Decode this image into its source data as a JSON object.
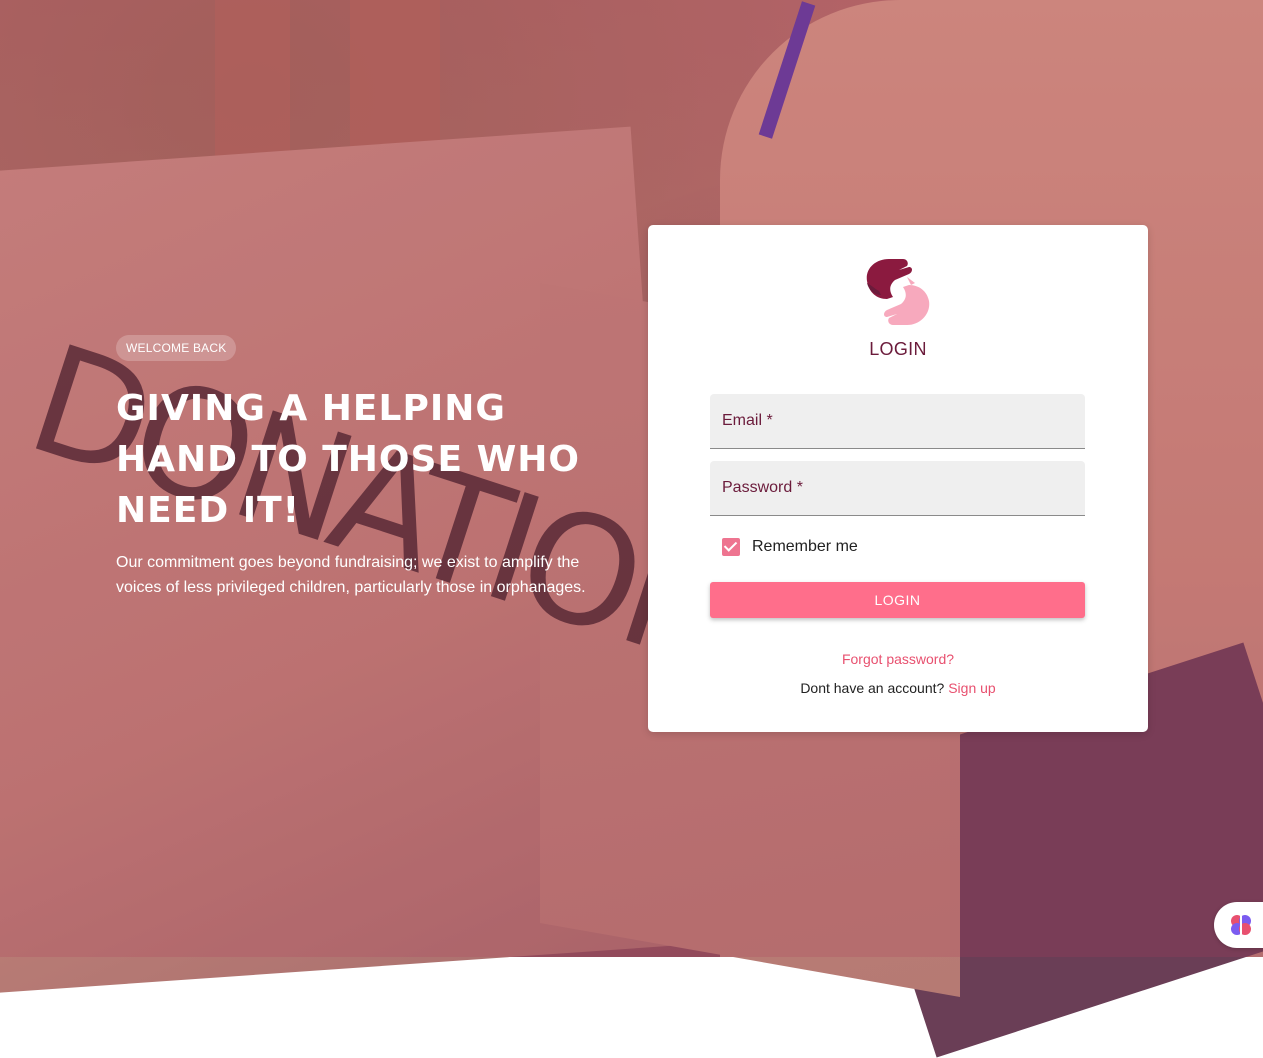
{
  "hero": {
    "badge": "WELCOME BACK",
    "headline": "GIVING A HELPING HAND TO THOSE WHO NEED IT!",
    "tagline": "Our commitment goes beyond fundraising; we exist to amplify the voices of less privileged children, particularly those in orphanages."
  },
  "background": {
    "box_text": "DONATION"
  },
  "login_card": {
    "title": "LOGIN",
    "email_label": "Email *",
    "password_label": "Password *",
    "remember_label": "Remember me",
    "remember_checked": true,
    "login_button": "LOGIN",
    "forgot_password": "Forgot password?",
    "no_account_text": "Dont have an account?",
    "signup_link": "Sign up"
  },
  "colors": {
    "accent": "#ff6e8b",
    "brand_dark": "#6b1b3b",
    "link": "#e8506f"
  },
  "icons": {
    "logo": "helping-hands-logo-icon",
    "fab": "brain-icon"
  }
}
